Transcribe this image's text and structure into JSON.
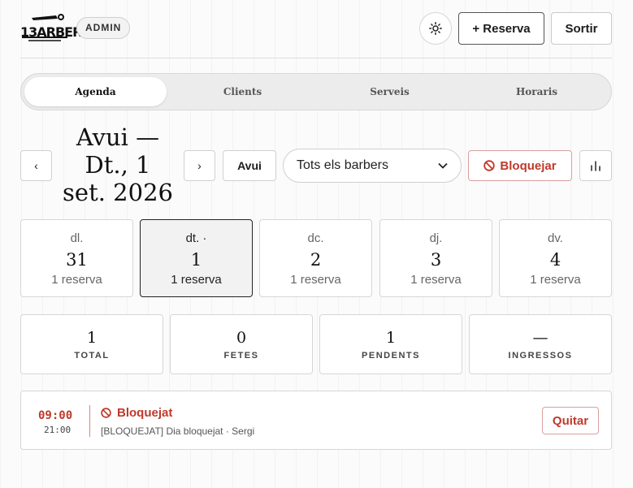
{
  "header": {
    "logo_text": "13ARBER",
    "role_badge": "ADMIN",
    "new_booking_label": "+ Reserva",
    "logout_label": "Sortir"
  },
  "tabs": [
    {
      "label": "Agenda",
      "active": true
    },
    {
      "label": "Clients",
      "active": false
    },
    {
      "label": "Serveis",
      "active": false
    },
    {
      "label": "Horaris",
      "active": false
    }
  ],
  "date_nav": {
    "title_line1": "Avui —",
    "title_line2": "Dt., 1",
    "title_line3": "set. 2026",
    "prev_label": "‹",
    "next_label": "›",
    "today_label": "Avui",
    "barber_filter": "Tots els barbers",
    "block_label": "Bloquejar"
  },
  "days": [
    {
      "name": "dl.",
      "number": "31",
      "count": "1 reserva",
      "active": false
    },
    {
      "name": "dt. ·",
      "number": "1",
      "count": "1 reserva",
      "active": true
    },
    {
      "name": "dc.",
      "number": "2",
      "count": "1 reserva",
      "active": false
    },
    {
      "name": "dj.",
      "number": "3",
      "count": "1 reserva",
      "active": false
    },
    {
      "name": "dv.",
      "number": "4",
      "count": "1 reserva",
      "active": false
    }
  ],
  "stats": [
    {
      "value": "1",
      "label": "TOTAL"
    },
    {
      "value": "0",
      "label": "FETES"
    },
    {
      "value": "1",
      "label": "PENDENTS"
    },
    {
      "value": "—",
      "label": "INGRESSOS"
    }
  ],
  "event": {
    "start": "09:00",
    "end": "21:00",
    "title": "Bloquejat",
    "subtitle": "[BLOQUEJAT] Dia bloquejat · Sergi",
    "remove_label": "Quitar"
  },
  "colors": {
    "accent_red": "#c0392b",
    "border": "#d6d6d6",
    "background": "#fbfbfb"
  }
}
